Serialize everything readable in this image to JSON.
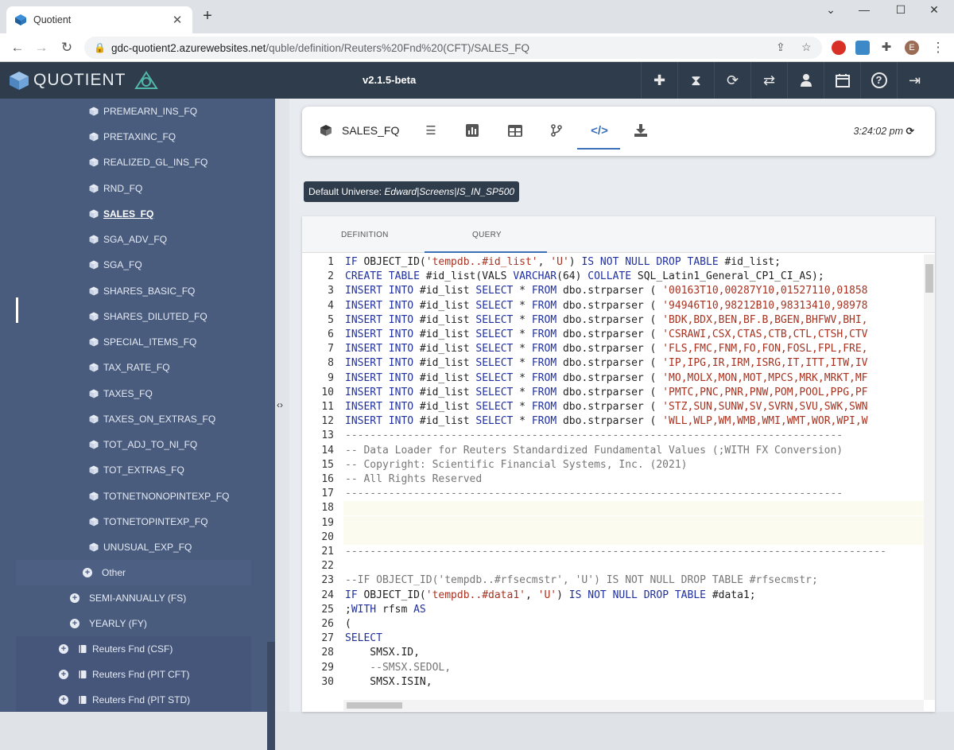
{
  "browser": {
    "tab_title": "Quotient",
    "url_host": "gdc-quotient2.azurewebsites.net",
    "url_path": "/quble/definition/Reuters%20Fnd%20(CFT)/SALES_FQ",
    "avatar_letter": "E"
  },
  "app": {
    "logo_text": "QUOTIENT",
    "version": "v2.1.5-beta",
    "header_icons": [
      "plus-icon",
      "hourglass-icon",
      "refresh-icon",
      "sync-icon",
      "user-icon",
      "calendar-icon",
      "help-icon",
      "logout-icon"
    ]
  },
  "sidebar": {
    "items": [
      {
        "label": "PREMEARN_INS_FQ"
      },
      {
        "label": "PRETAXINC_FQ"
      },
      {
        "label": "REALIZED_GL_INS_FQ"
      },
      {
        "label": "RND_FQ"
      },
      {
        "label": "SALES_FQ"
      },
      {
        "label": "SGA_ADV_FQ"
      },
      {
        "label": "SGA_FQ"
      },
      {
        "label": "SHARES_BASIC_FQ"
      },
      {
        "label": "SHARES_DILUTED_FQ"
      },
      {
        "label": "SPECIAL_ITEMS_FQ"
      },
      {
        "label": "TAX_RATE_FQ"
      },
      {
        "label": "TAXES_FQ"
      },
      {
        "label": "TAXES_ON_EXTRAS_FQ"
      },
      {
        "label": "TOT_ADJ_TO_NI_FQ"
      },
      {
        "label": "TOT_EXTRAS_FQ"
      },
      {
        "label": "TOTNETNONOPINTEXP_FQ"
      },
      {
        "label": "TOTNETOPINTEXP_FQ"
      },
      {
        "label": "UNUSUAL_EXP_FQ"
      }
    ],
    "groups": [
      {
        "label": "Other"
      },
      {
        "label": "SEMI-ANNUALLY (FS)"
      },
      {
        "label": "YEARLY (FY)"
      },
      {
        "label": "Reuters Fnd (CSF)"
      },
      {
        "label": "Reuters Fnd (PIT CFT)"
      },
      {
        "label": "Reuters Fnd (PIT STD)"
      }
    ]
  },
  "toolbar": {
    "quble_name": "SALES_FQ",
    "time": "3:24:02 pm",
    "icons": [
      "list-icon",
      "bar-chart-icon",
      "table-icon",
      "branch-icon",
      "code-icon",
      "download-icon"
    ]
  },
  "universe": {
    "label": "Default Universe:",
    "value": "Edward|Screens|IS_IN_SP500"
  },
  "editor": {
    "tabs": [
      "DEFINITION",
      "QUERY"
    ],
    "active_tab": "QUERY",
    "line_numbers": [
      "1",
      "2",
      "3",
      "4",
      "5",
      "6",
      "7",
      "8",
      "9",
      "10",
      "11",
      "12",
      "13",
      "14",
      "15",
      "16",
      "17",
      "18",
      "19",
      "20",
      "21",
      "22",
      "23",
      "24",
      "25",
      "26",
      "27",
      "28",
      "29",
      "30"
    ],
    "lines": [
      "IF OBJECT_ID('tempdb..#id_list', 'U') IS NOT NULL DROP TABLE #id_list;",
      "CREATE TABLE #id_list(VALS VARCHAR(64) COLLATE SQL_Latin1_General_CP1_CI_AS);",
      "INSERT INTO #id_list SELECT * FROM dbo.strparser ( '00163T10,00287Y10,01527110,01858",
      "INSERT INTO #id_list SELECT * FROM dbo.strparser ( '94946T10,98212B10,98313410,98978",
      "INSERT INTO #id_list SELECT * FROM dbo.strparser ( 'BDK,BDX,BEN,BF.B,BGEN,BHFWV,BHI,",
      "INSERT INTO #id_list SELECT * FROM dbo.strparser ( 'CSRAWI,CSX,CTAS,CTB,CTL,CTSH,CTV",
      "INSERT INTO #id_list SELECT * FROM dbo.strparser ( 'FLS,FMC,FNM,FO,FON,FOSL,FPL,FRE,",
      "INSERT INTO #id_list SELECT * FROM dbo.strparser ( 'IP,IPG,IR,IRM,ISRG,IT,ITT,ITW,IV",
      "INSERT INTO #id_list SELECT * FROM dbo.strparser ( 'MO,MOLX,MON,MOT,MPCS,MRK,MRKT,MF",
      "INSERT INTO #id_list SELECT * FROM dbo.strparser ( 'PMTC,PNC,PNR,PNW,POM,POOL,PPG,PF",
      "INSERT INTO #id_list SELECT * FROM dbo.strparser ( 'STZ,SUN,SUNW,SV,SVRN,SVU,SWK,SWN",
      "INSERT INTO #id_list SELECT * FROM dbo.strparser ( 'WLL,WLP,WM,WMB,WMI,WMT,WOR,WPI,W",
      "--------------------------------------------------------------------------------",
      "-- Data Loader for Reuters Standardized Fundamental Values (;WITH FX Conversion)",
      "-- Copyright: Scientific Financial Systems, Inc. (2021)",
      "-- All Rights Reserved",
      "--------------------------------------------------------------------------------",
      "",
      "",
      "",
      "---------------------------------------------------------------------------------------",
      "",
      "--IF OBJECT_ID('tempdb..#rfsecmstr', 'U') IS NOT NULL DROP TABLE #rfsecmstr;",
      "IF OBJECT_ID('tempdb..#data1', 'U') IS NOT NULL DROP TABLE #data1;",
      ";WITH rfsm AS",
      "(",
      "SELECT",
      "    SMSX.ID,",
      "    --SMSX.SEDOL,",
      "    SMSX.ISIN,"
    ]
  }
}
